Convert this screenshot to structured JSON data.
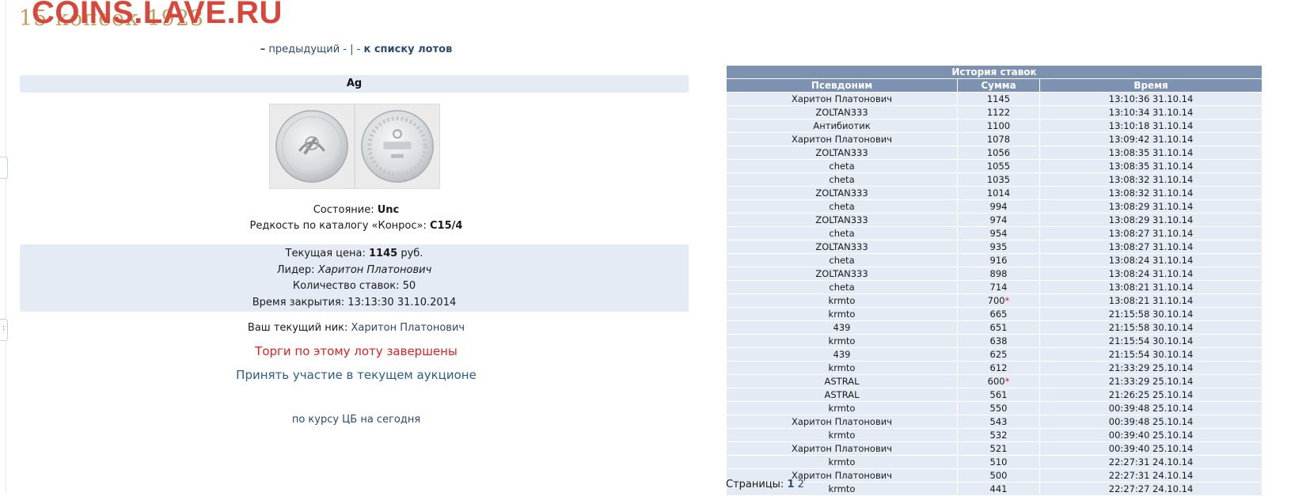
{
  "watermark": "COINS.LAVE.RU",
  "title": "15 копеек 1923",
  "nav": {
    "dash_left": "–",
    "prev": "предыдущий",
    "sep": "- | -",
    "to_list": "к списку лотов"
  },
  "lot": {
    "metal": "Ag",
    "state_label": "Состояние:",
    "state_value": "Unc",
    "rarity_label": "Редкость по каталогу «Конрос»:",
    "rarity_value": "C15/4"
  },
  "price": {
    "current_label": "Текущая цена:",
    "current_value": "1145",
    "currency": "руб.",
    "leader_label": "Лидер:",
    "leader_value": "Харитон Платонович",
    "bids_label": "Количество ставок:",
    "bids_value": "50",
    "close_label": "Время закрытия:",
    "close_value": "13:13:30 31.10.2014"
  },
  "user": {
    "nick_label": "Ваш текущий ник:",
    "nick_value": "Харитон Платонович"
  },
  "status_closed": "Торги по этому лоту завершены",
  "join_link": "Принять участие в текущем аукционе",
  "cb_link": "по курсу ЦБ на сегодня",
  "history": {
    "caption": "История ставок",
    "headers": [
      "Псевдоним",
      "Сумма",
      "Время"
    ],
    "rows": [
      {
        "nick": "Харитон Платонович",
        "amount": "1145",
        "time": "13:10:36 31.10.14",
        "star": false
      },
      {
        "nick": "ZOLTAN333",
        "amount": "1122",
        "time": "13:10:34 31.10.14",
        "star": false
      },
      {
        "nick": "Антибиотик",
        "amount": "1100",
        "time": "13:10:18 31.10.14",
        "star": false
      },
      {
        "nick": "Харитон Платонович",
        "amount": "1078",
        "time": "13:09:42 31.10.14",
        "star": false
      },
      {
        "nick": "ZOLTAN333",
        "amount": "1056",
        "time": "13:08:35 31.10.14",
        "star": false
      },
      {
        "nick": "cheta",
        "amount": "1055",
        "time": "13:08:35 31.10.14",
        "star": false
      },
      {
        "nick": "cheta",
        "amount": "1035",
        "time": "13:08:32 31.10.14",
        "star": false
      },
      {
        "nick": "ZOLTAN333",
        "amount": "1014",
        "time": "13:08:32 31.10.14",
        "star": false
      },
      {
        "nick": "cheta",
        "amount": "994",
        "time": "13:08:29 31.10.14",
        "star": false
      },
      {
        "nick": "ZOLTAN333",
        "amount": "974",
        "time": "13:08:29 31.10.14",
        "star": false
      },
      {
        "nick": "cheta",
        "amount": "954",
        "time": "13:08:27 31.10.14",
        "star": false
      },
      {
        "nick": "ZOLTAN333",
        "amount": "935",
        "time": "13:08:27 31.10.14",
        "star": false
      },
      {
        "nick": "cheta",
        "amount": "916",
        "time": "13:08:24 31.10.14",
        "star": false
      },
      {
        "nick": "ZOLTAN333",
        "amount": "898",
        "time": "13:08:24 31.10.14",
        "star": false
      },
      {
        "nick": "cheta",
        "amount": "714",
        "time": "13:08:21 31.10.14",
        "star": false
      },
      {
        "nick": "krmto",
        "amount": "700",
        "time": "13:08:21 31.10.14",
        "star": true
      },
      {
        "nick": "krmto",
        "amount": "665",
        "time": "21:15:58 30.10.14",
        "star": false
      },
      {
        "nick": "439",
        "amount": "651",
        "time": "21:15:58 30.10.14",
        "star": false
      },
      {
        "nick": "krmto",
        "amount": "638",
        "time": "21:15:54 30.10.14",
        "star": false
      },
      {
        "nick": "439",
        "amount": "625",
        "time": "21:15:54 30.10.14",
        "star": false
      },
      {
        "nick": "krmto",
        "amount": "612",
        "time": "21:33:29 25.10.14",
        "star": false
      },
      {
        "nick": "ASTRAL",
        "amount": "600",
        "time": "21:33:29 25.10.14",
        "star": true
      },
      {
        "nick": "ASTRAL",
        "amount": "561",
        "time": "21:26:25 25.10.14",
        "star": false
      },
      {
        "nick": "krmto",
        "amount": "550",
        "time": "00:39:48 25.10.14",
        "star": false
      },
      {
        "nick": "Харитон Платонович",
        "amount": "543",
        "time": "00:39:48 25.10.14",
        "star": false
      },
      {
        "nick": "krmto",
        "amount": "532",
        "time": "00:39:40 25.10.14",
        "star": false
      },
      {
        "nick": "Харитон Платонович",
        "amount": "521",
        "time": "00:39:40 25.10.14",
        "star": false
      },
      {
        "nick": "krmto",
        "amount": "510",
        "time": "22:27:31 24.10.14",
        "star": false
      },
      {
        "nick": "Харитон Платонович",
        "amount": "500",
        "time": "22:27:31 24.10.14",
        "star": false
      },
      {
        "nick": "krmto",
        "amount": "441",
        "time": "22:27:27 24.10.14",
        "star": false
      }
    ],
    "star_symbol": "*"
  },
  "pages": {
    "label": "Страницы:",
    "current": "1",
    "other": "2"
  }
}
